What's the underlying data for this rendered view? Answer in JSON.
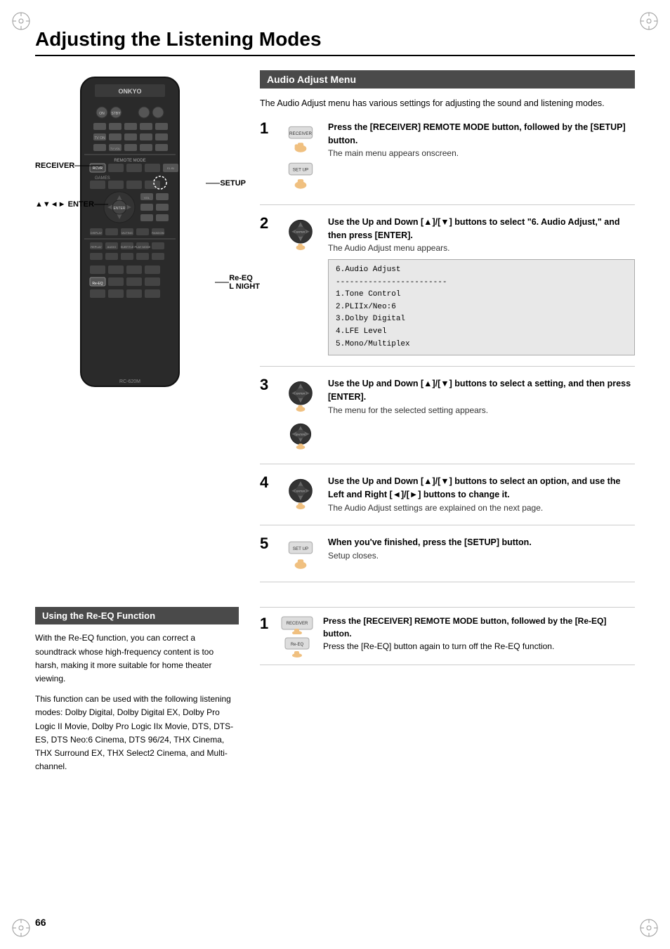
{
  "page": {
    "title": "Adjusting the Listening Modes",
    "page_number": "66"
  },
  "audio_adjust_menu": {
    "header": "Audio Adjust Menu",
    "intro": "The Audio Adjust menu has various settings for adjusting the sound and listening modes.",
    "steps": [
      {
        "number": "1",
        "instruction": "Press the [RECEIVER] REMOTE MODE button, followed by the [SETUP] button.",
        "sub_instruction": "The main menu appears onscreen.",
        "has_menu": false
      },
      {
        "number": "2",
        "instruction": "Use the Up and Down [▲]/[▼] buttons to select \"6. Audio Adjust,\" and then press [ENTER].",
        "sub_instruction": "The Audio Adjust menu appears.",
        "has_menu": true,
        "menu_content": "6.Audio Adjust\n------------------------\n1.Tone Control\n2.PLIIx/Neo:6\n3.Dolby Digital\n4.LFE Level\n5.Mono/Multiplex"
      },
      {
        "number": "3",
        "instruction": "Use the Up and Down [▲]/[▼] buttons to select a setting, and then press [ENTER].",
        "sub_instruction": "The menu for the selected setting appears.",
        "has_menu": false
      },
      {
        "number": "4",
        "instruction": "Use the Up and Down [▲]/[▼] buttons to select an option, and use the Left and Right [◄]/[►] buttons to change it.",
        "sub_instruction": "The Audio Adjust settings are explained on the next page.",
        "has_menu": false
      },
      {
        "number": "5",
        "instruction": "When you've finished, press the [SETUP] button.",
        "sub_instruction": "Setup closes.",
        "has_menu": false
      }
    ]
  },
  "re_eq": {
    "header": "Using the Re-EQ Function",
    "paragraphs": [
      "With the Re-EQ function, you can correct a soundtrack whose high-frequency content is too harsh, making it more suitable for home theater viewing.",
      "This function can be used with the following listening modes: Dolby Digital, Dolby Digital EX, Dolby Pro Logic II Movie, Dolby Pro Logic IIx Movie, DTS, DTS-ES, DTS Neo:6 Cinema, DTS 96/24, THX Cinema, THX Surround EX, THX Select2 Cinema, and Multi-channel."
    ],
    "step": {
      "number": "1",
      "instruction": "Press the [RECEIVER] REMOTE MODE button, followed by the [Re-EQ] button.",
      "sub_instruction": "Press the [Re-EQ] button again to turn off the Re-EQ function."
    }
  },
  "remote_labels": {
    "receiver": "RECEIVER",
    "enter": "▲▼◄► ENTER",
    "setup": "SETUP",
    "re_eq_l_night": "Re-EQ\nL NIGHT"
  }
}
